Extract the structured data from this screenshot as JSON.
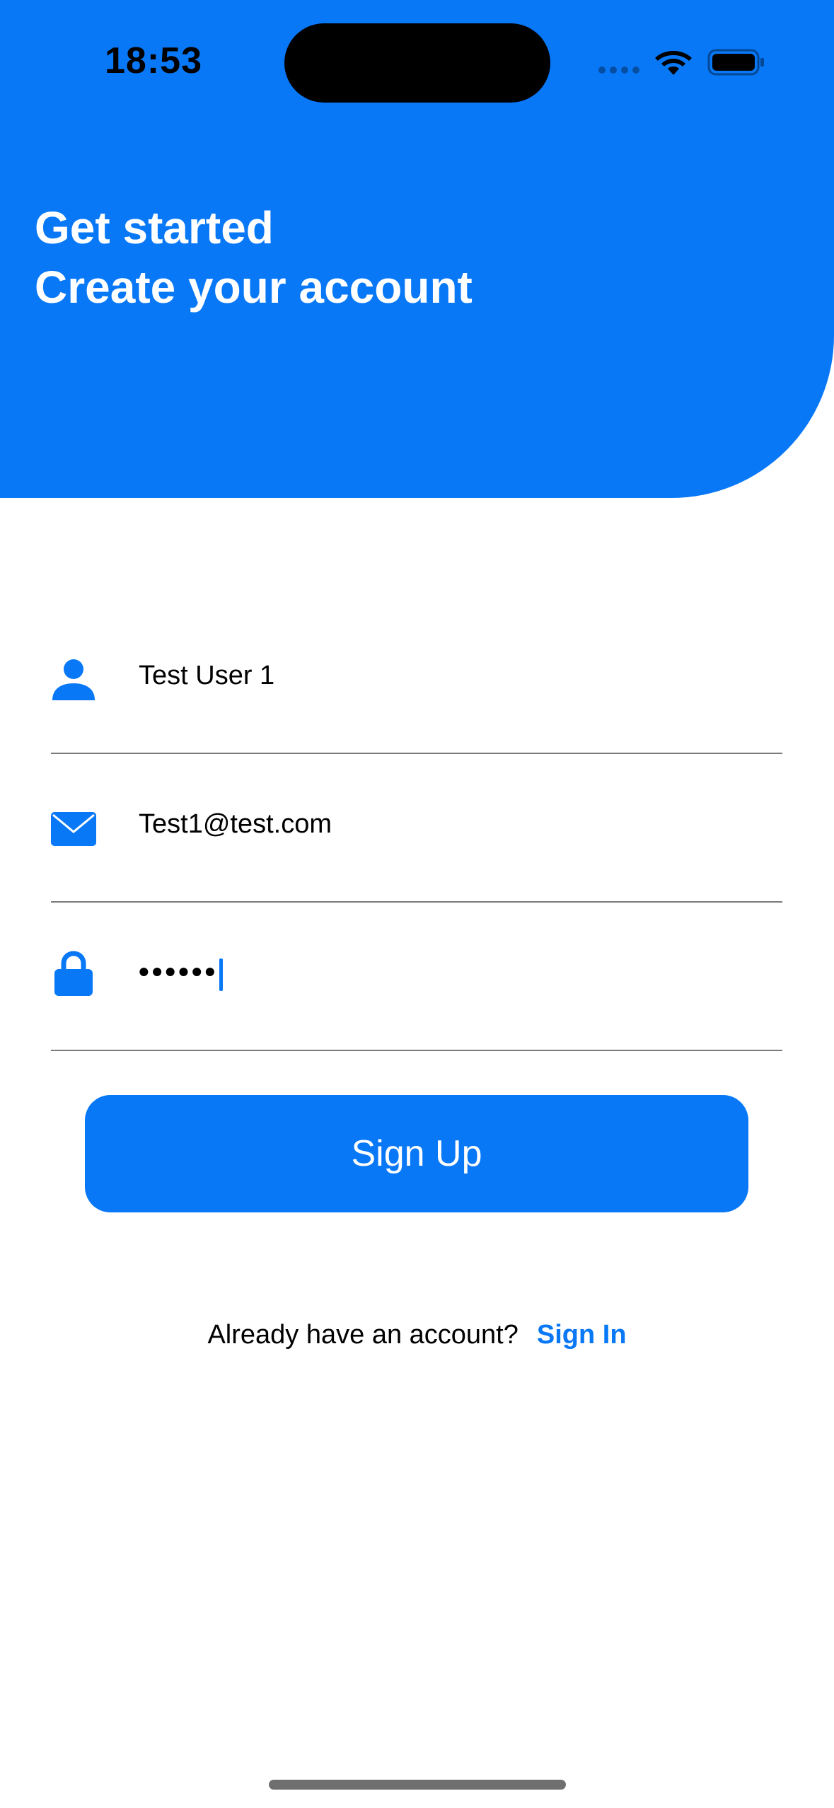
{
  "status_bar": {
    "time": "18:53"
  },
  "header": {
    "title": "Get started",
    "subtitle": "Create your account",
    "background_color": "#0878F7"
  },
  "form": {
    "name": {
      "icon": "person-icon",
      "value": "Test User 1"
    },
    "email": {
      "icon": "envelope-icon",
      "value": "Test1@test.com"
    },
    "password": {
      "icon": "lock-icon",
      "masked_value": "••••••"
    }
  },
  "buttons": {
    "signup_label": "Sign Up"
  },
  "footer": {
    "prompt": "Already have an account?",
    "signin_label": "Sign In"
  },
  "colors": {
    "accent": "#0878F7",
    "text": "#000000",
    "divider": "#7a7a7a"
  }
}
